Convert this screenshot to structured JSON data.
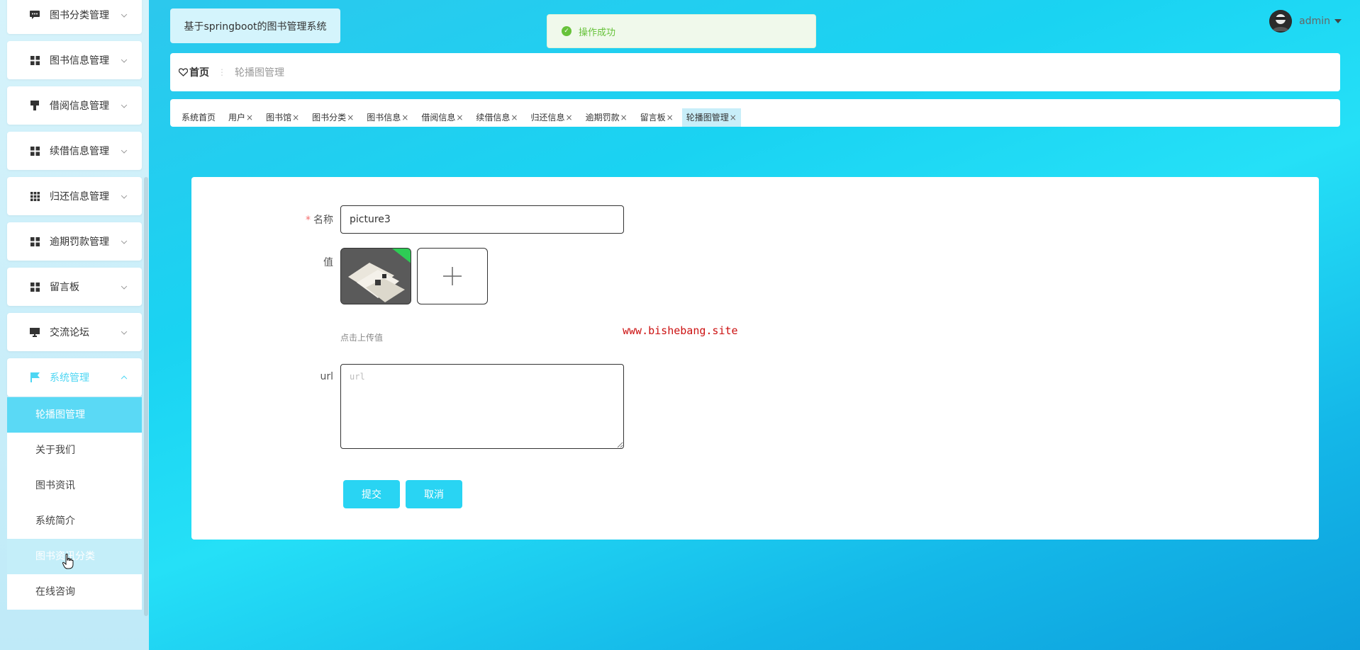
{
  "sidebar": {
    "menus": [
      {
        "label": "图书分类管理",
        "icon": "chat-bubble-icon"
      },
      {
        "label": "图书信息管理",
        "icon": "grid-icon"
      },
      {
        "label": "借阅信息管理",
        "icon": "brush-icon"
      },
      {
        "label": "续借信息管理",
        "icon": "grid-icon"
      },
      {
        "label": "归还信息管理",
        "icon": "apps-grid-icon"
      },
      {
        "label": "逾期罚款管理",
        "icon": "grid-icon"
      },
      {
        "label": "留言板",
        "icon": "grid-icon"
      },
      {
        "label": "交流论坛",
        "icon": "monitor-icon"
      },
      {
        "label": "系统管理",
        "icon": "flag-icon"
      }
    ],
    "submenu": [
      "轮播图管理",
      "关于我们",
      "图书资讯",
      "系统简介",
      "图书资讯分类",
      "在线咨询"
    ]
  },
  "header": {
    "brand": "基于springboot的图书管理系统",
    "toast": "操作成功",
    "user": "admin"
  },
  "breadcrumb": {
    "home": "首页",
    "current": "轮播图管理"
  },
  "tabs": [
    "系统首页",
    "用户",
    "图书馆",
    "图书分类",
    "图书信息",
    "借阅信息",
    "续借信息",
    "归还信息",
    "逾期罚款",
    "留言板",
    "轮播图管理"
  ],
  "form": {
    "name_label": "名称",
    "name_value": "picture3",
    "value_label": "值",
    "upload_tip": "点击上传值",
    "url_label": "url",
    "url_placeholder": "url",
    "submit": "提交",
    "cancel": "取消"
  },
  "watermark": "www.bishebang.site",
  "colors": {
    "accent": "#29d4f3",
    "success": "#67c23a",
    "required": "#f56c6c"
  }
}
